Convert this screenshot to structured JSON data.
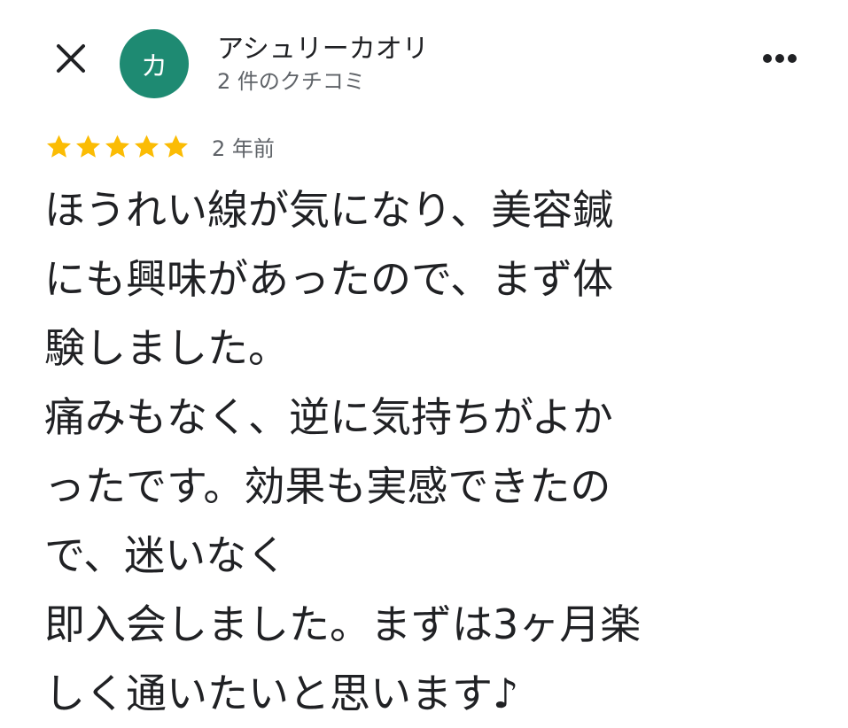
{
  "header": {
    "close_icon": "close-icon",
    "avatar_initial": "カ",
    "avatar_color": "#1e8a72",
    "reviewer_name": "アシュリーカオリ",
    "review_count": "2 件のクチコミ",
    "more_icon": "more-horiz-icon"
  },
  "review": {
    "rating": 5,
    "rating_max": 5,
    "star_color": "#fbbc04",
    "date": "2 年前",
    "lines": [
      "ほうれい線が気になり、美容鍼",
      "にも興味があったので、まず体",
      "験しました。",
      "痛みもなく、逆に気持ちがよか",
      "ったです。効果も実感できたの",
      "で、迷いなく",
      "即入会しました。まずは3ヶ月楽",
      "しく通いたいと思います♪"
    ]
  }
}
